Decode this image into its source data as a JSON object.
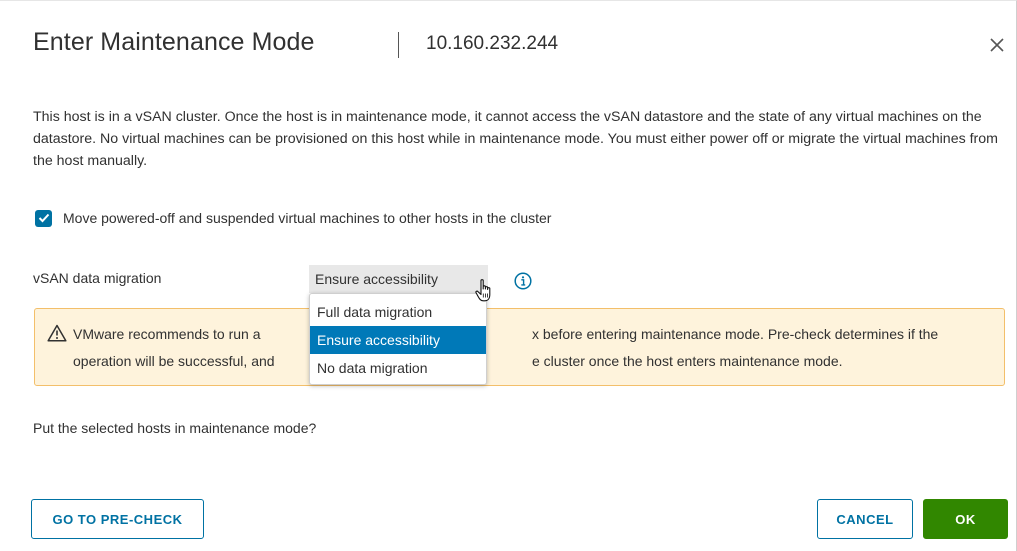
{
  "dialog": {
    "title": "Enter Maintenance Mode",
    "host": "10.160.232.244",
    "description": "This host is in a vSAN cluster. Once the host is in maintenance mode, it cannot access the vSAN datastore and the state of any virtual machines on the datastore. No virtual machines can be provisioned on this host while in maintenance mode. You must either power off or migrate the virtual machines from the host manually.",
    "move_vms": {
      "checked": true,
      "label": "Move powered-off and suspended virtual machines to other hosts in the cluster"
    },
    "vsan_migration": {
      "label": "vSAN data migration",
      "selected": "Ensure accessibility",
      "options": [
        "Full data migration",
        "Ensure accessibility",
        "No data migration"
      ]
    },
    "warning": {
      "line1_left": "VMware recommends to run a",
      "line1_right": "x before entering maintenance mode. Pre-check determines if the",
      "line2_left": "operation will be successful, and",
      "line2_right": "e cluster once the host enters maintenance mode."
    },
    "question": "Put the selected hosts in maintenance mode?",
    "buttons": {
      "precheck": "GO TO PRE-CHECK",
      "cancel": "CANCEL",
      "ok": "OK"
    }
  },
  "colors": {
    "primary": "#0072a3",
    "selected_option": "#0079b8",
    "ok_button": "#318700",
    "warning_bg": "#fef3dc",
    "warning_border": "#f3bf6a"
  },
  "icons": {
    "close": "close-icon",
    "check": "check-icon",
    "info": "info-icon",
    "warning": "warning-icon",
    "cursor": "hand-cursor-icon"
  }
}
